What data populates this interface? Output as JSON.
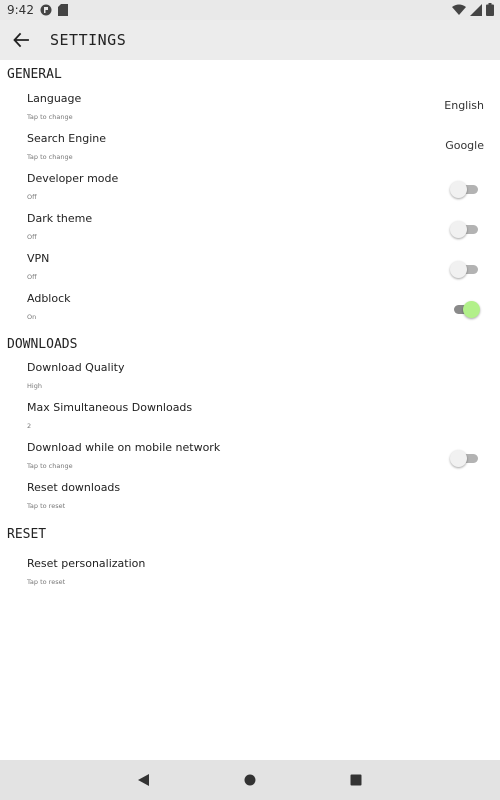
{
  "status_bar": {
    "time": "9:42"
  },
  "app_bar": {
    "title": "SETTINGS"
  },
  "sections": {
    "general": {
      "header": "GENERAL",
      "language": {
        "title": "Language",
        "subtitle": "Tap to change",
        "value": "English"
      },
      "search_engine": {
        "title": "Search Engine",
        "subtitle": "Tap to change",
        "value": "Google"
      },
      "developer_mode": {
        "title": "Developer mode",
        "subtitle": "Off",
        "enabled": false
      },
      "dark_theme": {
        "title": "Dark theme",
        "subtitle": "Off",
        "enabled": false
      },
      "vpn": {
        "title": "VPN",
        "subtitle": "Off",
        "enabled": false
      },
      "adblock": {
        "title": "Adblock",
        "subtitle": "On",
        "enabled": true
      }
    },
    "downloads": {
      "header": "DOWNLOADS",
      "download_quality": {
        "title": "Download Quality",
        "subtitle": "High"
      },
      "max_simultaneous": {
        "title": "Max Simultaneous Downloads",
        "subtitle": "2"
      },
      "mobile_network": {
        "title": "Download while on mobile network",
        "subtitle": "Tap to change",
        "enabled": false
      },
      "reset_downloads": {
        "title": "Reset downloads",
        "subtitle": "Tap to reset"
      }
    },
    "reset": {
      "header": "RESET",
      "reset_personalization": {
        "title": "Reset personalization",
        "subtitle": "Tap to reset"
      }
    }
  },
  "colors": {
    "app_bar_bg": "#ececec",
    "nav_bar_bg": "#e3e3e3",
    "toggle_on_thumb": "#b2f08a",
    "toggle_off_track": "#b3b3b3"
  },
  "icons": {
    "back": "arrow-left-icon",
    "wifi": "wifi-icon",
    "signal": "signal-icon",
    "battery": "battery-icon",
    "nav_back": "triangle-back-icon",
    "nav_home": "circle-home-icon",
    "nav_recents": "square-recents-icon"
  }
}
